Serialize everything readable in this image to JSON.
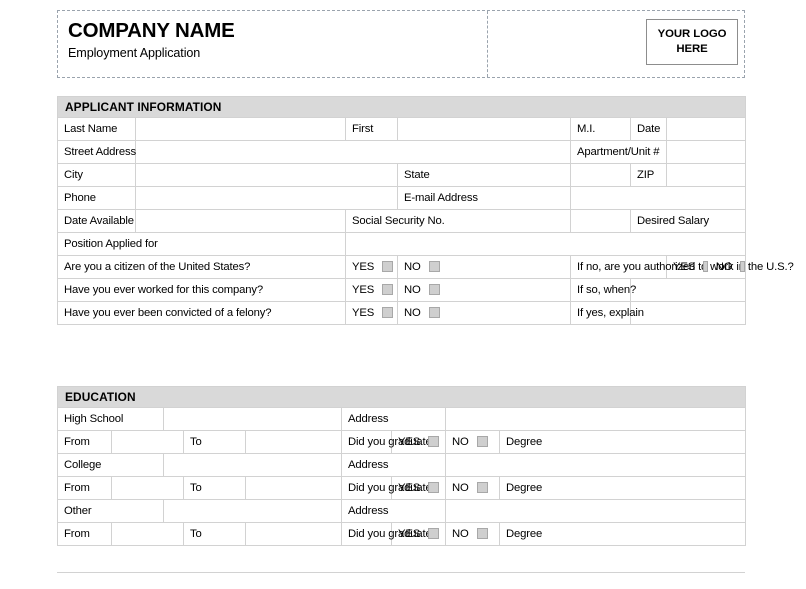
{
  "header": {
    "company_name": "COMPANY NAME",
    "tagline": "Employment Application",
    "logo_line1": "YOUR LOGO",
    "logo_line2": "HERE"
  },
  "applicant_section": {
    "title": "APPLICANT INFORMATION",
    "labels": {
      "last_name": "Last Name",
      "first": "First",
      "mi": "M.I.",
      "date": "Date",
      "street_address": "Street Address",
      "apartment_unit": "Apartment/Unit #",
      "city": "City",
      "state": "State",
      "zip": "ZIP",
      "phone": "Phone",
      "email": "E-mail Address",
      "date_available": "Date Available",
      "ssn": "Social Security No.",
      "desired_salary": "Desired Salary",
      "position_applied_for": "Position Applied for"
    },
    "questions": [
      {
        "text": "Are you a citizen of the United States?",
        "yes": "YES",
        "no": "NO",
        "followup": "If no, are you authorized to work in the U.S.?",
        "followup_yes": "YES",
        "followup_no": "NO"
      },
      {
        "text": "Have you ever worked for this company?",
        "yes": "YES",
        "no": "NO",
        "followup": "If so, when?"
      },
      {
        "text": "Have you ever been convicted of a felony?",
        "yes": "YES",
        "no": "NO",
        "followup": "If yes, explain"
      }
    ]
  },
  "education_section": {
    "title": "EDUCATION",
    "labels": {
      "high_school": "High School",
      "college": "College",
      "other": "Other",
      "address": "Address",
      "from": "From",
      "to": "To",
      "did_you_graduate": "Did you graduate?",
      "yes": "YES",
      "no": "NO",
      "degree": "Degree"
    }
  },
  "colors": {
    "section_header_fill": "#d9d9d9",
    "grid_line": "#d2d2d2",
    "checkbox_fill": "#cfcfcf",
    "checkbox_border": "#a8a8a8",
    "dashed_border": "#9aa3ad"
  }
}
